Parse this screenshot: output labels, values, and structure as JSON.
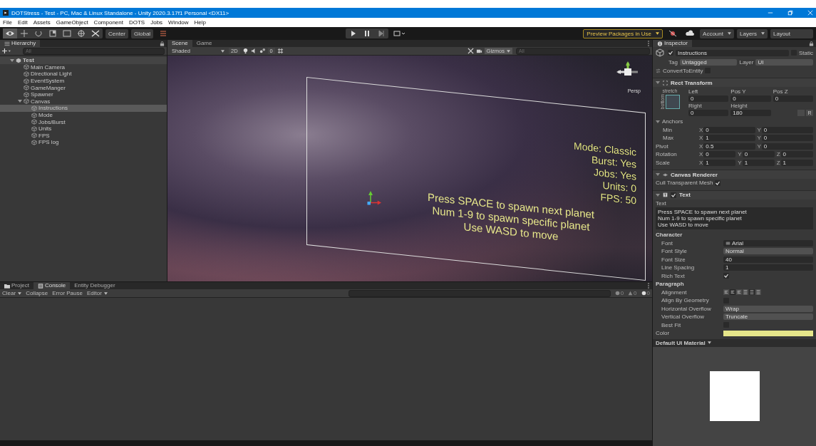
{
  "window": {
    "title": "DOTStress - Test - PC, Mac & Linux Standalone - Unity 2020.3.17f1 Personal <DX11>"
  },
  "menu": [
    "File",
    "Edit",
    "Assets",
    "GameObject",
    "Component",
    "DOTS",
    "Jobs",
    "Window",
    "Help"
  ],
  "toolbar": {
    "pivot": "Center",
    "space": "Global",
    "preview_packages": "Preview Packages in Use",
    "account": "Account",
    "layers": "Layers",
    "layout": "Layout"
  },
  "hierarchy": {
    "title": "Hierarchy",
    "search_placeholder": "All",
    "tree": [
      {
        "name": "Test",
        "kind": "scene",
        "expanded": true,
        "selected": false,
        "children": [
          {
            "name": "Main Camera",
            "kind": "object",
            "selected": false
          },
          {
            "name": "Directional Light",
            "kind": "object",
            "selected": false
          },
          {
            "name": "EventSystem",
            "kind": "object",
            "selected": false
          },
          {
            "name": "GameManger",
            "kind": "object",
            "selected": false
          },
          {
            "name": "Spawner",
            "kind": "object",
            "selected": false
          },
          {
            "name": "Canvas",
            "kind": "object",
            "expanded": true,
            "selected": false,
            "children": [
              {
                "name": "Instructions",
                "kind": "object",
                "selected": true
              },
              {
                "name": "Mode",
                "kind": "object",
                "selected": false
              },
              {
                "name": "Jobs/Burst",
                "kind": "object",
                "selected": false
              },
              {
                "name": "Units",
                "kind": "object",
                "selected": false
              },
              {
                "name": "FPS",
                "kind": "object",
                "selected": false
              },
              {
                "name": "FPS log",
                "kind": "object",
                "selected": false
              }
            ]
          }
        ]
      }
    ]
  },
  "scene_tabs": [
    {
      "label": "Scene",
      "selected": true
    },
    {
      "label": "Game",
      "selected": false
    }
  ],
  "scene_toolbar": {
    "shading": "Shaded",
    "mode_2d": "2D",
    "hidden_count": "0",
    "gizmos": "Gizmos",
    "search_placeholder": "All",
    "projection": "Persp"
  },
  "scene_overlay": {
    "stats": [
      "Mode: Classic",
      "Burst: Yes",
      "Jobs: Yes",
      "Units: 0",
      "FPS: 50"
    ],
    "instructions": [
      "Press SPACE to spawn next planet",
      "Num 1-9 to spawn specific planet",
      "Use WASD to move"
    ]
  },
  "bottom_tabs": [
    {
      "label": "Project",
      "selected": false
    },
    {
      "label": "Console",
      "selected": true
    },
    {
      "label": "Entity Debugger",
      "selected": false
    }
  ],
  "console_toolbar": {
    "buttons": [
      "Clear",
      "Collapse",
      "Error Pause",
      "Editor"
    ],
    "counts": [
      "0",
      "0",
      "0"
    ]
  },
  "inspector": {
    "title": "Inspector",
    "object": {
      "active": true,
      "name": "Instructions",
      "static_checked": false,
      "static_label": "Static",
      "tag_label": "Tag",
      "tag": "Untagged",
      "layer_label": "Layer",
      "layer": "UI",
      "convert_label": "ConvertToEntity",
      "convert_checked": false
    },
    "rect_transform": {
      "title": "Rect Transform",
      "expanded": true,
      "anchor_preset_h": "stretch",
      "anchor_preset_v": "bottom",
      "fields": [
        {
          "label": "Left",
          "value": "0"
        },
        {
          "label": "Pos Y",
          "value": "0"
        },
        {
          "label": "Pos Z",
          "value": "0"
        },
        {
          "label": "Right",
          "value": "0"
        },
        {
          "label": "Height",
          "value": "180"
        }
      ],
      "raw_button": "R",
      "anchors": {
        "label": "Anchors",
        "expanded": true,
        "children": [
          {
            "label": "Min",
            "fields": [
              {
                "axis": "X",
                "value": "0"
              },
              {
                "axis": "Y",
                "value": "0"
              }
            ]
          },
          {
            "label": "Max",
            "fields": [
              {
                "axis": "X",
                "value": "1"
              },
              {
                "axis": "Y",
                "value": "0"
              }
            ]
          }
        ]
      },
      "rows": [
        {
          "label": "Pivot",
          "fields": [
            {
              "axis": "X",
              "value": "0.5"
            },
            {
              "axis": "Y",
              "value": "0"
            }
          ]
        },
        {
          "label": "Rotation",
          "fields": [
            {
              "axis": "X",
              "value": "0"
            },
            {
              "axis": "Y",
              "value": "0"
            },
            {
              "axis": "Z",
              "value": "0"
            }
          ]
        },
        {
          "label": "Scale",
          "fields": [
            {
              "axis": "X",
              "value": "1"
            },
            {
              "axis": "Y",
              "value": "1"
            },
            {
              "axis": "Z",
              "value": "1"
            }
          ]
        }
      ]
    },
    "canvas_renderer": {
      "title": "Canvas Renderer",
      "expanded": true,
      "cull_label": "Cull Transparent Mesh",
      "cull_checked": true
    },
    "text": {
      "title": "Text",
      "expanded": true,
      "enabled": true,
      "text_label": "Text",
      "content": "Press SPACE to spawn next planet\nNum 1-9 to spawn specific planet\nUse WASD to move",
      "sections": [
        {
          "title": "Character",
          "rows": [
            {
              "kind": "object",
              "label": "Font",
              "value": "Arial"
            },
            {
              "kind": "dropdown",
              "label": "Font Style",
              "value": "Normal"
            },
            {
              "kind": "field",
              "label": "Font Size",
              "value": "40"
            },
            {
              "kind": "field",
              "label": "Line Spacing",
              "value": "1"
            },
            {
              "kind": "checkbox",
              "label": "Rich Text",
              "checked": true
            }
          ]
        },
        {
          "title": "Paragraph",
          "rows": [
            {
              "kind": "alignment",
              "label": "Alignment"
            },
            {
              "kind": "checkbox",
              "label": "Align By Geometry",
              "checked": false
            },
            {
              "kind": "dropdown",
              "label": "Horizontal Overflow",
              "value": "Wrap"
            },
            {
              "kind": "dropdown",
              "label": "Vertical Overflow",
              "value": "Truncate"
            },
            {
              "kind": "checkbox",
              "label": "Best Fit",
              "checked": false
            }
          ]
        }
      ],
      "color_label": "Color",
      "color": "#e6e68a"
    },
    "material": "Default UI Material"
  }
}
